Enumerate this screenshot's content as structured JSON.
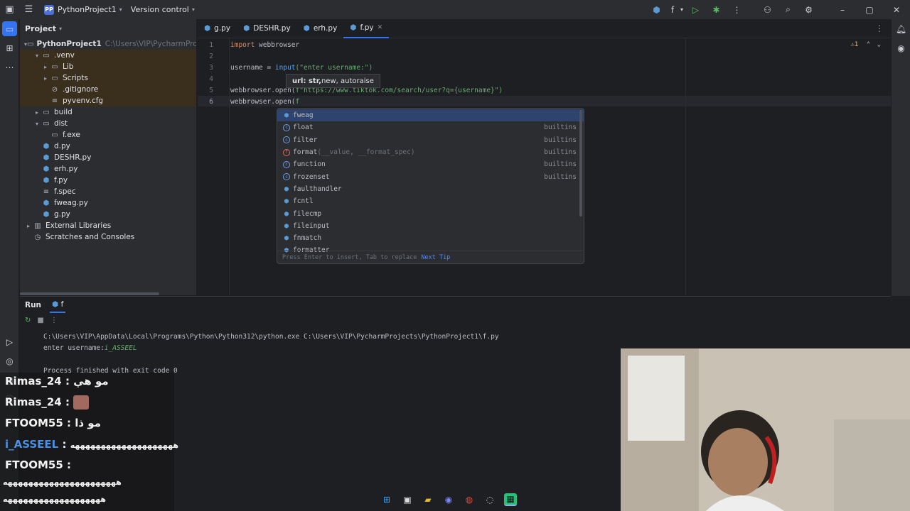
{
  "titlebar": {
    "project_badge": "PP",
    "project_name": "PythonProject1",
    "vcs": "Version control",
    "run_config": "f"
  },
  "project_panel": {
    "title": "Project",
    "root": "PythonProject1",
    "root_path": "C:\\Users\\VIP\\PycharmProjects\\PythonProject1",
    "items": [
      {
        "label": ".venv",
        "indent": 1,
        "arrow": "▾",
        "type": "folder"
      },
      {
        "label": "Lib",
        "indent": 2,
        "arrow": "▸",
        "type": "folder"
      },
      {
        "label": "Scripts",
        "indent": 2,
        "arrow": "▸",
        "type": "folder"
      },
      {
        "label": ".gitignore",
        "indent": 2,
        "arrow": "",
        "type": "ignore"
      },
      {
        "label": "pyvenv.cfg",
        "indent": 2,
        "arrow": "",
        "type": "cfg"
      },
      {
        "label": "build",
        "indent": 1,
        "arrow": "▸",
        "type": "folder"
      },
      {
        "label": "dist",
        "indent": 1,
        "arrow": "▾",
        "type": "folder"
      },
      {
        "label": "f.exe",
        "indent": 2,
        "arrow": "",
        "type": "exe"
      },
      {
        "label": "d.py",
        "indent": 1,
        "arrow": "",
        "type": "py"
      },
      {
        "label": "DESHR.py",
        "indent": 1,
        "arrow": "",
        "type": "py"
      },
      {
        "label": "erh.py",
        "indent": 1,
        "arrow": "",
        "type": "py"
      },
      {
        "label": "f.py",
        "indent": 1,
        "arrow": "",
        "type": "py"
      },
      {
        "label": "f.spec",
        "indent": 1,
        "arrow": "",
        "type": "spec"
      },
      {
        "label": "fweag.py",
        "indent": 1,
        "arrow": "",
        "type": "py"
      },
      {
        "label": "g.py",
        "indent": 1,
        "arrow": "",
        "type": "py"
      },
      {
        "label": "External Libraries",
        "indent": 0,
        "arrow": "▸",
        "type": "lib"
      },
      {
        "label": "Scratches and Consoles",
        "indent": 0,
        "arrow": "",
        "type": "scratch"
      }
    ]
  },
  "tabs": [
    {
      "label": "g.py",
      "active": false
    },
    {
      "label": "DESHR.py",
      "active": false
    },
    {
      "label": "erh.py",
      "active": false
    },
    {
      "label": "f.py",
      "active": true
    }
  ],
  "editor": {
    "line_numbers": [
      "1",
      "2",
      "3",
      "4",
      "5",
      "6"
    ],
    "lines": [
      {
        "kw": "import",
        "rest": " webbrowser"
      },
      {
        "kw": "",
        "rest": ""
      },
      {
        "kw": "",
        "rest": "username = ",
        "fn": "input",
        "str": "(\"enter username:\")"
      },
      {
        "kw": "",
        "rest": ""
      },
      {
        "kw": "",
        "rest": "webbrowser.open(",
        "str": "f\"https://www.tiktok.com/search/user?q={username}\")"
      },
      {
        "kw": "",
        "rest": "webbrowser.open(",
        "str": "f"
      }
    ],
    "inspection": "⚠1",
    "param_hint_bold": "url: str,",
    "param_hint_rest": " new, autoraise"
  },
  "completion": {
    "items": [
      {
        "icon": "py",
        "name": "fweag",
        "args": "",
        "source": "",
        "selected": true
      },
      {
        "icon": "c",
        "name": "float",
        "args": "",
        "source": "builtins"
      },
      {
        "icon": "c",
        "name": "filter",
        "args": "",
        "source": "builtins"
      },
      {
        "icon": "m",
        "name": "format",
        "args": "(__value, __format_spec)",
        "source": "builtins"
      },
      {
        "icon": "c",
        "name": "function",
        "args": "",
        "source": "builtins"
      },
      {
        "icon": "c",
        "name": "frozenset",
        "args": "",
        "source": "builtins"
      },
      {
        "icon": "py",
        "name": "faulthandler",
        "args": "",
        "source": ""
      },
      {
        "icon": "py",
        "name": "fcntl",
        "args": "",
        "source": ""
      },
      {
        "icon": "py",
        "name": "filecmp",
        "args": "",
        "source": ""
      },
      {
        "icon": "py",
        "name": "fileinput",
        "args": "",
        "source": ""
      },
      {
        "icon": "py",
        "name": "fnmatch",
        "args": "",
        "source": ""
      },
      {
        "icon": "py",
        "name": "formatter",
        "args": "",
        "source": ""
      }
    ],
    "footer_text": "Press Enter to insert, Tab to replace",
    "footer_link": "Next Tip"
  },
  "run_panel": {
    "label": "Run",
    "tab": "f",
    "command": "C:\\Users\\VIP\\AppData\\Local\\Programs\\Python\\Python312\\python.exe C:\\Users\\VIP\\PycharmProjects\\PythonProject1\\f.py",
    "prompt": "enter username:",
    "input": "i_ASSEEL",
    "exit": "Process finished with exit code 0"
  },
  "chat": [
    {
      "user": "Rimas_24",
      "text": "مو هي"
    },
    {
      "user": "Rimas_24",
      "text": "",
      "sticker": true
    },
    {
      "user": "FTOOM55",
      "text": "مو ذا"
    },
    {
      "user": "i_ASSEEL",
      "text": "ههههههههههههههههههههه",
      "highlight": true
    },
    {
      "user": "FTOOM55",
      "text": ""
    },
    {
      "user": "",
      "text": "ههههههههههههههههههههههه"
    },
    {
      "user": "",
      "text": "هههههههههههههههههههه"
    }
  ],
  "colors": {
    "accent": "#3574f0",
    "background": "#1e1f22",
    "panel": "#2b2d30",
    "selection": "#2e436e"
  }
}
